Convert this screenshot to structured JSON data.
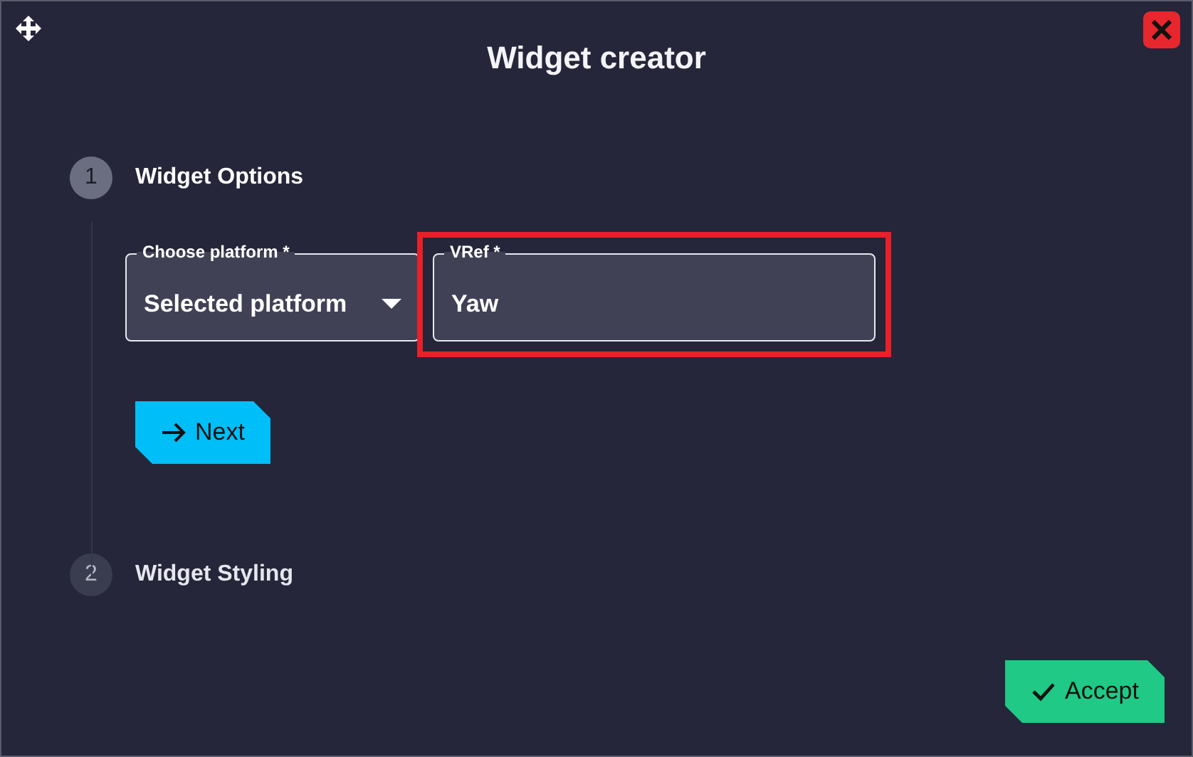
{
  "window": {
    "title": "Widget creator"
  },
  "steps": [
    {
      "number": "1",
      "label": "Widget Options",
      "selected": true
    },
    {
      "number": "2",
      "label": "Widget Styling",
      "selected": false
    }
  ],
  "fields": [
    {
      "kind": "select",
      "label": "Choose platform *",
      "value": "Selected platform",
      "highlighted": false
    },
    {
      "kind": "text",
      "label": "VRef *",
      "value": "Yaw",
      "highlighted": true
    }
  ],
  "next_button": {
    "label": "Next"
  },
  "accept_button": {
    "label": "Accept"
  }
}
